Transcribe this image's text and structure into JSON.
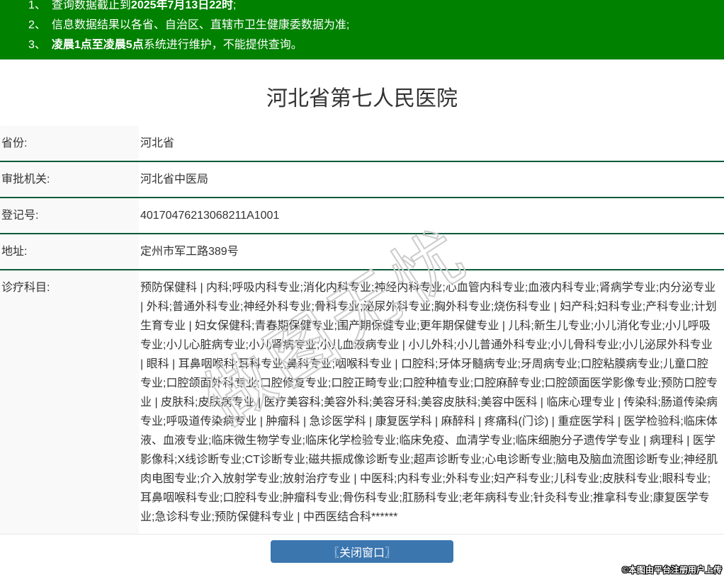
{
  "notice": {
    "items": [
      {
        "num": "1、",
        "pre": "查询数据截止到",
        "bold": "2025年7月13日22时",
        "post": ";"
      },
      {
        "num": "2、",
        "pre": "信息数据结果以各省、自治区、直辖市卫生健康委数据为准;",
        "bold": "",
        "post": ""
      },
      {
        "num": "3、",
        "pre": "",
        "bold": "凌晨1点至凌晨5点",
        "post": "系统进行维护，不能提供查询。"
      }
    ]
  },
  "title": "河北省第七人民医院",
  "table": {
    "rows": [
      {
        "label": "省份:",
        "value": "河北省"
      },
      {
        "label": "审批机关:",
        "value": "河北省中医局"
      },
      {
        "label": "登记号:",
        "value": "40170476213068211A1001"
      },
      {
        "label": "地址:",
        "value": "定州市军工路389号"
      },
      {
        "label": "诊疗科目:",
        "value": "预防保健科 | 内科;呼吸内科专业;消化内科专业;神经内科专业;心血管内科专业;血液内科专业;肾病学专业;内分泌专业 | 外科;普通外科专业;神经外科专业;骨科专业;泌尿外科专业;胸外科专业;烧伤科专业 | 妇产科;妇科专业;产科专业;计划生育专业 | 妇女保健科;青春期保健专业;围产期保健专业;更年期保健专业 | 儿科;新生儿专业;小儿消化专业;小儿呼吸专业;小儿心脏病专业;小儿肾病专业;小儿血液病专业 | 小儿外科;小儿普通外科专业;小儿骨科专业;小儿泌尿外科专业 | 眼科 | 耳鼻咽喉科;耳科专业;鼻科专业;咽喉科专业 | 口腔科;牙体牙髓病专业;牙周病专业;口腔粘膜病专业;儿童口腔专业;口腔颌面外科专业;口腔修复专业;口腔正畸专业;口腔种植专业;口腔麻醉专业;口腔颌面医学影像专业;预防口腔专业 | 皮肤科;皮肤病专业 | 医疗美容科;美容外科;美容牙科;美容皮肤科;美容中医科 | 临床心理专业 | 传染科;肠道传染病专业;呼吸道传染病专业 | 肿瘤科 | 急诊医学科 | 康复医学科 | 麻醉科 | 疼痛科(门诊) | 重症医学科 | 医学检验科;临床体液、血液专业;临床微生物学专业;临床化学检验专业;临床免疫、血清学专业;临床细胞分子遗传学专业 | 病理科 | 医学影像科;X线诊断专业;CT诊断专业;磁共振成像诊断专业;超声诊断专业;心电诊断专业;脑电及脑血流图诊断专业;神经肌肉电图专业;介入放射学专业;放射治疗专业 | 中医科;内科专业;外科专业;妇产科专业;儿科专业;皮肤科专业;眼科专业;耳鼻咽喉科专业;口腔科专业;肿瘤科专业;骨伤科专业;肛肠科专业;老年病科专业;针灸科专业;推拿科专业;康复医学专业;急诊科专业;预防保健科专业 | 中西医结合科******"
      }
    ]
  },
  "button": {
    "close_label": "〖关闭窗口〗"
  },
  "watermark": {
    "text": "做图无忧"
  },
  "attribution": "©本图由平台注册用户上传",
  "colors": {
    "header_green": "#008100",
    "table_border_green": "#0a5b3b",
    "label_bg": "#f9f9f9",
    "button_blue": "#3b76af",
    "text": "#333333"
  }
}
